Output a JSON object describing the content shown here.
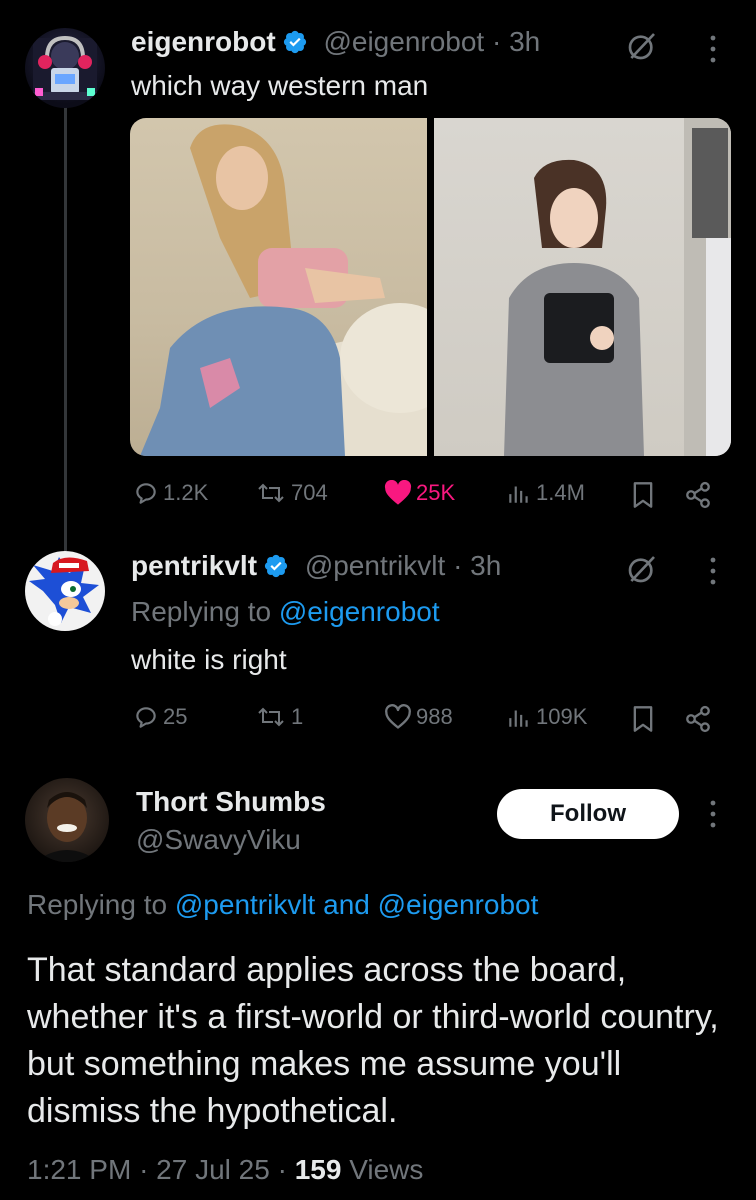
{
  "tweet1": {
    "name": "eigenrobot",
    "handle": "@eigenrobot",
    "dot": "·",
    "time": "3h",
    "text": "which way western man",
    "stats": {
      "replies": "1.2K",
      "retweets": "704",
      "likes": "25K",
      "views": "1.4M"
    },
    "liked": true
  },
  "tweet2": {
    "name": "pentrikvlt",
    "handle": "@pentrikvlt",
    "dot": "·",
    "time": "3h",
    "replying_prefix": "Replying to",
    "replying_to": "@eigenrobot",
    "text": "white is right",
    "stats": {
      "replies": "25",
      "retweets": "1",
      "likes": "988",
      "views": "109K"
    }
  },
  "tweet3": {
    "name": "Thort Shumbs",
    "handle": "@SwavyViku",
    "follow_label": "Follow",
    "replying_prefix": "Replying to",
    "replying_to_1": "@pentrikvlt",
    "and": "and",
    "replying_to_2": "@eigenrobot",
    "text": "That standard applies across the board, whether it's a first-world or third-world country, but something makes me assume you'll dismiss the hypothetical.",
    "meta_time": "1:21 PM",
    "meta_dot1": "·",
    "meta_date": "27 Jul 25",
    "meta_dot2": "·",
    "views_count": "159",
    "views_label": "Views"
  },
  "colors": {
    "background": "#000000",
    "text": "#e7e9ea",
    "secondary": "#71767b",
    "link": "#1d9bf0",
    "like": "#f91880",
    "verified": "#1d9bf0"
  },
  "icons": [
    "reply-icon",
    "retweet-icon",
    "like-icon",
    "views-icon",
    "bookmark-icon",
    "share-icon",
    "grok-icon",
    "more-icon",
    "verified-badge-icon"
  ]
}
